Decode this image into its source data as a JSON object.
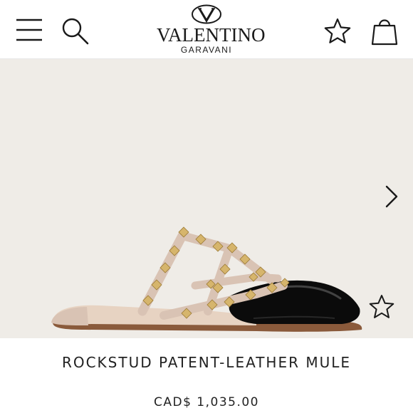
{
  "header": {
    "brand": "VALENTINO",
    "brand_sub": "GARAVANI",
    "icons": [
      "menu-icon",
      "search-icon",
      "star-icon",
      "shopping-bag-icon"
    ]
  },
  "gallery": {
    "background": "#efece7",
    "icons": [
      "chevron-right-icon",
      "star-icon"
    ]
  },
  "product": {
    "name": "ROCKSTUD PATENT-LEATHER MULE",
    "price": "CAD$ 1,035.00"
  },
  "colors": {
    "text": "#1a1a1a",
    "hero_bg": "#efece7",
    "strap": "#d9c3b4",
    "stud": "#d6b56c",
    "patent": "#0b0b0b",
    "sole": "#8a5a3b"
  }
}
